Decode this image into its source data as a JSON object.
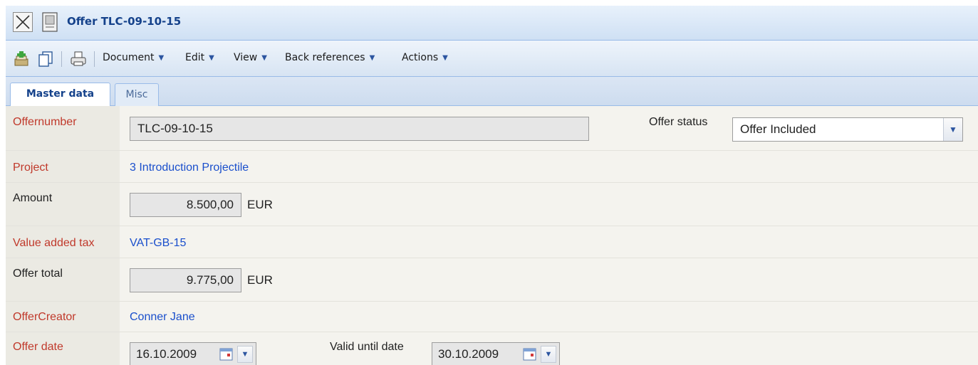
{
  "window": {
    "title": "Offer TLC-09-10-15"
  },
  "toolbar": {
    "icons": [
      "add-icon",
      "copy-icon",
      "print-icon"
    ],
    "menus": [
      "Document",
      "Edit",
      "View",
      "Back references",
      "Actions"
    ]
  },
  "tabs": [
    {
      "label": "Master data",
      "active": true
    },
    {
      "label": "Misc",
      "active": false
    }
  ],
  "form": {
    "offernumber": {
      "label": "Offernumber",
      "value": "TLC-09-10-15"
    },
    "offer_status": {
      "label": "Offer status",
      "value": "Offer Included"
    },
    "project": {
      "label": "Project",
      "value": "3 Introduction Projectile"
    },
    "amount": {
      "label": "Amount",
      "value": "8.500,00",
      "unit": "EUR"
    },
    "vat": {
      "label": "Value added tax",
      "value": "VAT-GB-15"
    },
    "offer_total": {
      "label": "Offer total",
      "value": "9.775,00",
      "unit": "EUR"
    },
    "offer_creator": {
      "label": "OfferCreator",
      "value": "Conner Jane"
    },
    "offer_date": {
      "label": "Offer date",
      "value": "16.10.2009"
    },
    "valid_until": {
      "label": "Valid until date",
      "value": "30.10.2009"
    }
  },
  "colors": {
    "required_label": "#c0392b",
    "link": "#1a4fcc",
    "title": "#15428b"
  }
}
